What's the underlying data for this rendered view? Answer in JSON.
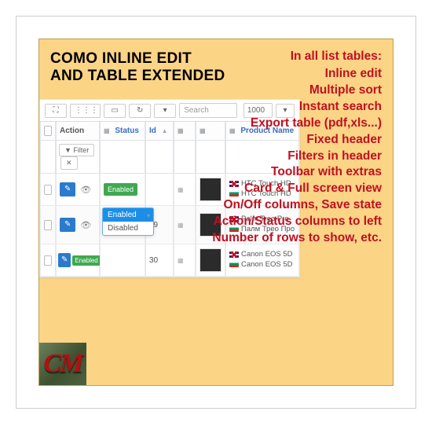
{
  "title": {
    "line1": "COMO INLINE EDIT",
    "line2": "AND TABLE EXTENDED"
  },
  "features": {
    "heading": "In all list tables:",
    "items": [
      "Inline edit",
      "Multiple sort",
      "Instant search",
      "Export table (pdf,xls...)",
      "Fixed header",
      "Filters in header",
      "Toolbar with extras",
      "Card & Full screen view",
      "On/Off columns, Save state",
      "Action/Status columns to left",
      "Number of rows to show, etc."
    ]
  },
  "toolbar": {
    "search_placeholder": "Search",
    "page_size": "1000"
  },
  "table": {
    "headers": {
      "action": "Action",
      "status": "Status",
      "id": "Id",
      "product_name": "Product Name"
    },
    "filter_label": "Filter",
    "status_options": {
      "enabled": "Enabled",
      "disabled": "Disabled"
    },
    "rows": [
      {
        "id": "",
        "status": "Enabled",
        "name_en": "HTC Touch HD",
        "name_alt": "HTC Touch HD"
      },
      {
        "id": "29",
        "status_editing": true,
        "name_en": "Palm Treo Pro",
        "name_alt": "Палм Трео Про"
      },
      {
        "id": "30",
        "status": "Enabled",
        "name_en": "Canon EOS 5D",
        "name_alt": "Canon EOS 5D"
      }
    ]
  },
  "logo": "CM"
}
